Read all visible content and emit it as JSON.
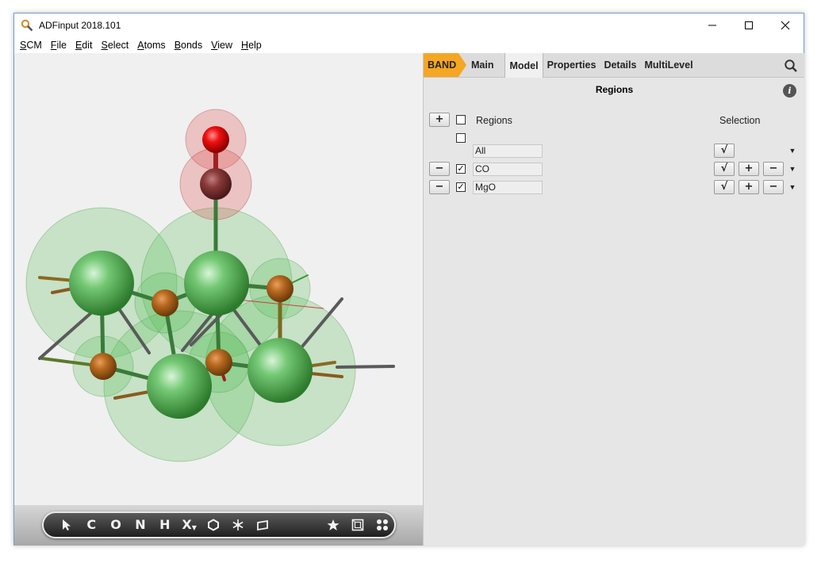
{
  "window": {
    "title": "ADFinput 2018.101"
  },
  "menu": [
    {
      "accel": "S",
      "rest": "CM"
    },
    {
      "accel": "F",
      "rest": "ile"
    },
    {
      "accel": "E",
      "rest": "dit"
    },
    {
      "accel": "S",
      "rest": "elect"
    },
    {
      "accel": "A",
      "rest": "toms"
    },
    {
      "accel": "B",
      "rest": "onds"
    },
    {
      "accel": "V",
      "rest": "iew"
    },
    {
      "accel": "H",
      "rest": "elp"
    }
  ],
  "toolbar": {
    "items": [
      "C",
      "O",
      "N",
      "H",
      "X"
    ]
  },
  "tabs": {
    "band": "BAND",
    "items": [
      "Main",
      "Model",
      "Properties",
      "Details",
      "MultiLevel"
    ],
    "active": "Model"
  },
  "regions": {
    "title": "Regions",
    "col_regions": "Regions",
    "col_selection": "Selection",
    "add_label": "+",
    "remove_label": "−",
    "select_label": "√",
    "rows": [
      {
        "name": "All",
        "checked": false
      },
      {
        "name": "CO",
        "checked": true
      },
      {
        "name": "MgO",
        "checked": true
      }
    ]
  },
  "colors": {
    "band_accent": "#f5a623",
    "oxygen": "#e81010",
    "magnesium": "#5fbf5f"
  }
}
